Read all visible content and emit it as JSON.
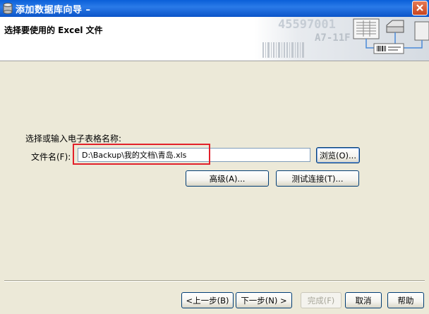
{
  "window": {
    "title": "添加数据库向导 –",
    "close_icon": "close-icon",
    "title_icon": "database-icon"
  },
  "header": {
    "title": "选择要使用的 Excel 文件",
    "art_text": [
      "45597001",
      "A7-11F"
    ]
  },
  "form": {
    "sheet_label": "选择或输入电子表格名称:",
    "file_label": "文件名(F):",
    "file_value": "D:\\Backup\\我的文档\\青岛.xls",
    "browse_label": "浏览(O)...",
    "advanced_label": "高级(A)...",
    "test_label": "测试连接(T)..."
  },
  "footer": {
    "back_label": "<上一步(B)",
    "next_label": "下一步(N) >",
    "finish_label": "完成(F)",
    "cancel_label": "取消",
    "help_label": "帮助"
  },
  "colors": {
    "highlight": "#e2202a",
    "titlebar": "#0a5fd8"
  }
}
